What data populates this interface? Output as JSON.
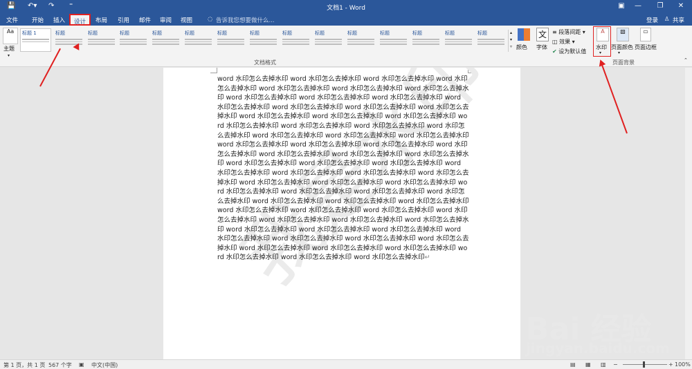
{
  "titlebar": {
    "title": "文档1 - Word",
    "save_icon": "save-icon",
    "undo_icon": "undo-icon",
    "redo_icon": "redo-icon"
  },
  "tabs": {
    "file": "文件",
    "home": "开始",
    "insert": "插入",
    "design": "设计",
    "layout": "布局",
    "references": "引用",
    "mailings": "邮件",
    "review": "审阅",
    "view": "视图",
    "tell_me": "告诉我您想要做什么...",
    "signin": "登录",
    "share": "共享"
  },
  "ribbon": {
    "theme_label": "主题",
    "gallery_item_title": "标题",
    "gallery_first_title": "标题 1",
    "colors_label": "颜色",
    "fonts_label": "字体",
    "para_spacing": "段落间距",
    "effects": "效果",
    "set_default": "设为默认值",
    "watermark_label": "水印",
    "page_color_label": "页面颜色",
    "page_border_label": "页面边框",
    "group_doc_format": "文档格式",
    "group_page_bg": "页面背景"
  },
  "document": {
    "body": "word 水印怎么去掉水印 word 水印怎么去掉水印 word 水印怎么去掉水印 word 水印怎么去掉水印 word 水印怎么去掉水印 word 水印怎么去掉水印 word 水印怎么去掉水印 word 水印怎么去掉水印 word 水印怎么去掉水印 word 水印怎么去掉水印 word 水印怎么去掉水印 word 水印怎么去掉水印 word 水印怎么去掉水印 word 水印怎么去掉水印 word 水印怎么去掉水印 word 水印怎么去掉水印 word 水印怎么去掉水印 word 水印怎么去掉水印 word 水印怎么去掉水印 word 水印怎么去掉水印 word 水印怎么去掉水印 word 水印怎么去掉水印 word 水印怎么去掉水印 word 水印怎么去掉水印 word 水印怎么去掉水印 word 水印怎么去掉水印 word 水印怎么去掉水印 word 水印怎么去掉水印 word 水印怎么去掉水印 word 水印怎么去掉水印 word 水印怎么去掉水印 word 水印怎么去掉水印 word 水印怎么去掉水印 word 水印怎么去掉水印 word 水印怎么去掉水印 word 水印怎么去掉水印 word 水印怎么去掉水印 word 水印怎么去掉水印 word 水印怎么去掉水印 word 水印怎么去掉水印 word 水印怎么去掉水印 word 水印怎么去掉水印 word 水印怎么去掉水印 word 水印怎么去掉水印 word 水印怎么去掉水印 word 水印怎么去掉水印 word 水印怎么去掉水印 word 水印怎么去掉水印 word 水印怎么去掉水印 word 水印怎么去掉水印 word 水印怎么去掉水印 word 水印怎么去掉水印 word 水印怎么去掉水印 word 水印怎么去掉水印 word 水印怎么去掉水印 word 水印怎么去掉水印 word 水印怎么去掉水印 word 水印怎么去掉水印 word 水印怎么去掉水印 word 水印怎么去掉水印 word 水印怎么去掉水印 word 水印怎么去掉水印 word 水印怎么去掉水印 word 水印怎么去掉水印 word 水印怎么去掉水印 word 水印怎么去掉水印 word 水印怎么去掉水印 word 水印怎么去掉水印",
    "watermark_text": "我是水印"
  },
  "statusbar": {
    "page": "第 1 页，共 1 页",
    "words": "567 个字",
    "language": "中文(中国)",
    "zoom": "100%"
  },
  "overlay": {
    "baidu_logo": "Bai  经验",
    "baidu_url": "jingyan.baidu.com"
  },
  "colors": {
    "accent": "#2b579a",
    "highlight": "#e02020"
  }
}
